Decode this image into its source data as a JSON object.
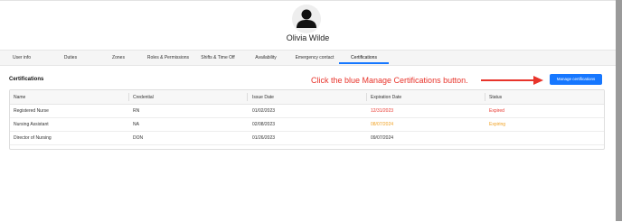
{
  "user": {
    "name": "Olivia Wilde"
  },
  "tabs": [
    {
      "label": "User info"
    },
    {
      "label": "Duties"
    },
    {
      "label": "Zones"
    },
    {
      "label": "Roles & Permissions"
    },
    {
      "label": "Shifts & Time Off"
    },
    {
      "label": "Availability"
    },
    {
      "label": "Emergency contact"
    },
    {
      "label": "Certifications",
      "active": true
    }
  ],
  "section": {
    "title": "Certifications"
  },
  "instruction": "Click the blue Manage Certifications button.",
  "manage_button": {
    "label": "Manage certifications"
  },
  "table": {
    "headers": [
      "Name",
      "Credential",
      "Issue Date",
      "Expiration Date",
      "Status"
    ],
    "rows": [
      {
        "name": "Registered Nurse",
        "credential": "RN",
        "issue_date": "01/02/2023",
        "expiration_date": "12/31/2023",
        "status": "Expired"
      },
      {
        "name": "Nursing Assistant",
        "credential": "NA",
        "issue_date": "02/08/2023",
        "expiration_date": "08/07/2024",
        "status": "Expiring"
      },
      {
        "name": "Director of Nursing",
        "credential": "DON",
        "issue_date": "01/26/2023",
        "expiration_date": "09/07/2024",
        "status": ""
      }
    ]
  },
  "colors": {
    "accent": "#1677ff",
    "expired": "#e8342b",
    "expiring": "#f0a020",
    "annotation": "#e8342b"
  }
}
